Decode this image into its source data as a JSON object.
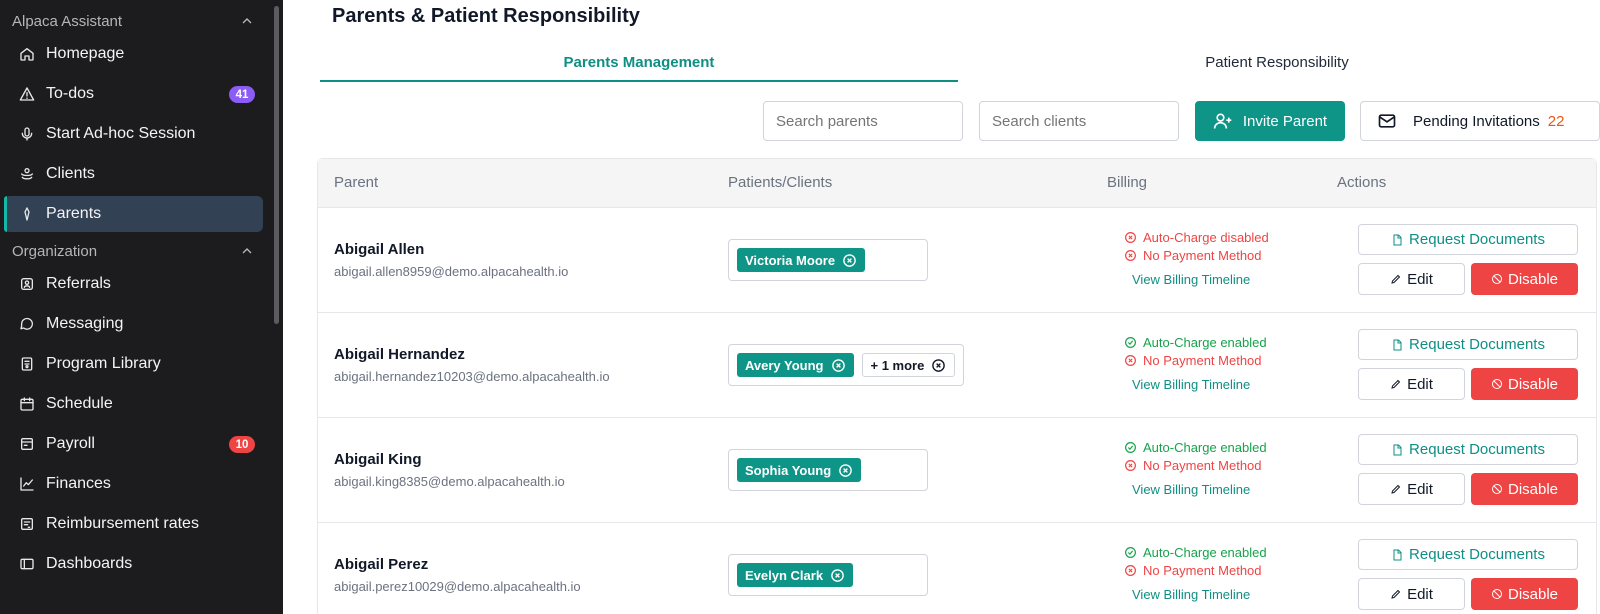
{
  "sidebar": {
    "section1": "Alpaca Assistant",
    "items1": [
      {
        "label": "Homepage",
        "icon": "home-icon"
      },
      {
        "label": "To-dos",
        "icon": "alert-triangle-icon",
        "badge": "41"
      },
      {
        "label": "Start Ad-hoc Session",
        "icon": "microphone-icon"
      },
      {
        "label": "Clients",
        "icon": "clients-icon"
      },
      {
        "label": "Parents",
        "icon": "parents-icon",
        "active": true
      }
    ],
    "section2": "Organization",
    "items2": [
      {
        "label": "Referrals",
        "icon": "referrals-icon"
      },
      {
        "label": "Messaging",
        "icon": "message-icon"
      },
      {
        "label": "Program Library",
        "icon": "library-icon"
      },
      {
        "label": "Schedule",
        "icon": "calendar-icon"
      },
      {
        "label": "Payroll",
        "icon": "payroll-icon",
        "badge": "10"
      },
      {
        "label": "Finances",
        "icon": "chart-line-icon"
      },
      {
        "label": "Reimbursement rates",
        "icon": "reimbursement-icon"
      },
      {
        "label": "Dashboards",
        "icon": "dashboard-icon"
      }
    ]
  },
  "page": {
    "title": "Parents & Patient Responsibility",
    "tabs": [
      "Parents Management",
      "Patient Responsibility"
    ]
  },
  "toolbar": {
    "search_parents_placeholder": "Search parents",
    "search_clients_placeholder": "Search clients",
    "invite_label": "Invite Parent",
    "pending_label": "Pending Invitations",
    "pending_count": "22"
  },
  "table": {
    "headers": [
      "Parent",
      "Patients/Clients",
      "Billing",
      "Actions"
    ],
    "actions": {
      "docs": "Request Documents",
      "edit": "Edit",
      "disable": "Disable"
    },
    "billing_link": "View Billing Timeline",
    "rows": [
      {
        "name": "Abigail Allen",
        "email": "abigail.allen8959@demo.alpacahealth.io",
        "clients": [
          "Victoria Moore"
        ],
        "more": "",
        "autocharge": "Auto-Charge disabled",
        "autocharge_ok": false,
        "payment": "No Payment Method"
      },
      {
        "name": "Abigail Hernandez",
        "email": "abigail.hernandez10203@demo.alpacahealth.io",
        "clients": [
          "Avery Young"
        ],
        "more": "+ 1 more",
        "autocharge": "Auto-Charge enabled",
        "autocharge_ok": true,
        "payment": "No Payment Method"
      },
      {
        "name": "Abigail King",
        "email": "abigail.king8385@demo.alpacahealth.io",
        "clients": [
          "Sophia Young"
        ],
        "more": "",
        "autocharge": "Auto-Charge enabled",
        "autocharge_ok": true,
        "payment": "No Payment Method"
      },
      {
        "name": "Abigail Perez",
        "email": "abigail.perez10029@demo.alpacahealth.io",
        "clients": [
          "Evelyn Clark"
        ],
        "more": "",
        "autocharge": "Auto-Charge enabled",
        "autocharge_ok": true,
        "payment": "No Payment Method"
      }
    ]
  }
}
